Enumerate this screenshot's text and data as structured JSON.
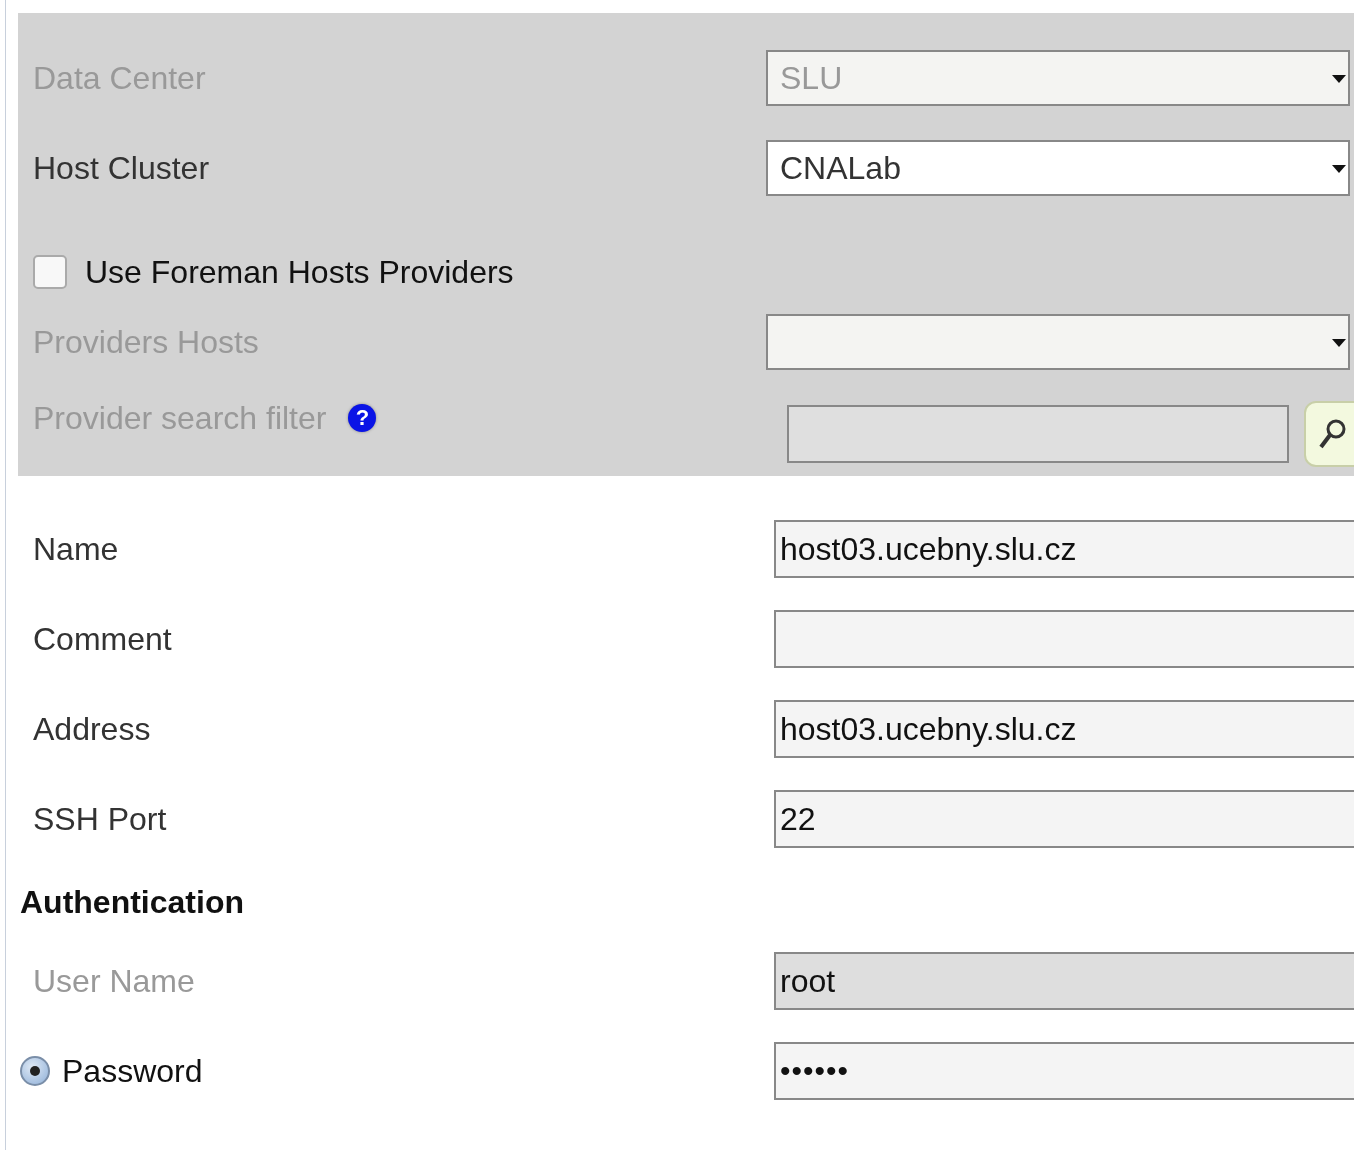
{
  "host_section": {
    "rows": [
      {
        "kind": "select",
        "label": "Data Center",
        "disabled": true,
        "value": "SLU"
      },
      {
        "kind": "select",
        "label": "Host Cluster",
        "disabled": false,
        "value": "CNALab"
      },
      {
        "kind": "checkbox",
        "label": "Use Foreman Hosts Providers",
        "checked": false
      },
      {
        "kind": "select",
        "label": "Providers Hosts",
        "disabled": true
      },
      {
        "kind": "search",
        "label": "Provider search filter",
        "disabled": true,
        "help": "?"
      }
    ]
  },
  "fields": [
    {
      "label": "Name",
      "value": "host03.ucebny.slu.cz"
    },
    {
      "label": "Comment"
    },
    {
      "label": "Address",
      "value": "host03.ucebny.slu.cz"
    },
    {
      "label": "SSH Port",
      "value": "22"
    }
  ],
  "authentication": {
    "title": "Authentication",
    "fields": [
      {
        "kind": "text",
        "label": "User Name",
        "disabled": true,
        "value": "root"
      },
      {
        "kind": "password",
        "label": "Password",
        "selected": true,
        "value": "••••••"
      }
    ]
  }
}
